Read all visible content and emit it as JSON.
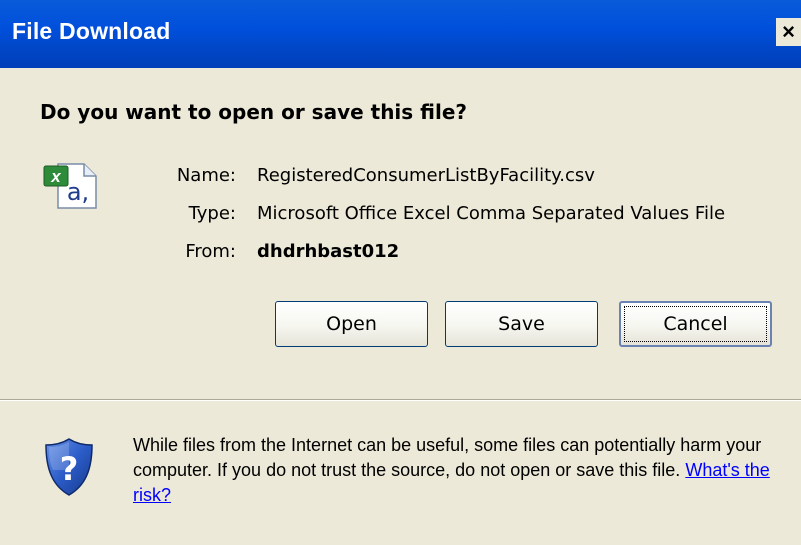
{
  "window": {
    "title": "File Download",
    "close_glyph": "×"
  },
  "prompt": {
    "question": "Do you want to open or save this file?"
  },
  "file": {
    "icon": "excel-csv-file-icon",
    "name_label": "Name:",
    "name_value": "RegisteredConsumerListByFacility.csv",
    "type_label": "Type:",
    "type_value": "Microsoft Office Excel Comma Separated Values File",
    "from_label": "From:",
    "from_value": "dhdrhbast012"
  },
  "buttons": {
    "open": "Open",
    "save": "Save",
    "cancel": "Cancel"
  },
  "warning": {
    "icon": "security-shield-question-icon",
    "text": "While files from the Internet can be useful, some files can potentially harm your computer. If you do not trust the source, do not open or save this file.",
    "link_text": "What's the risk?"
  },
  "colors": {
    "titlebar": "#0050dc",
    "dialog_bg": "#ece9d8",
    "link": "#0000ff"
  }
}
